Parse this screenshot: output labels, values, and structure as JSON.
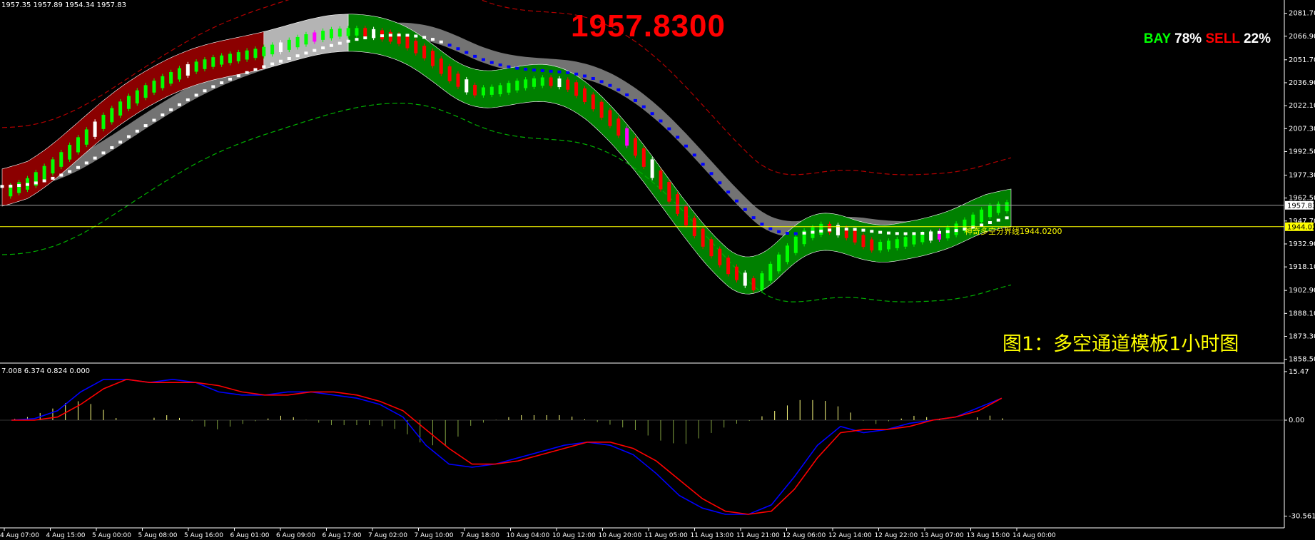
{
  "header": {
    "ohlc_text": "1957.35 1957.89 1954.34 1957.83",
    "big_price": "1957.8300",
    "signal": {
      "buy_label": "BAY",
      "buy_pct": "78%",
      "sell_label": "SELL",
      "sell_pct": "22%"
    },
    "caption": "图1：多空通道模板1小时图",
    "line_label": "神奇多空分界线1944.0200"
  },
  "macd_panel": {
    "info_text": "7.008 6.374 0.824 0.000"
  },
  "colors": {
    "up_candle": "#00ff00",
    "down_candle": "#ff0000",
    "white_candle": "#ffffff",
    "magenta_candle": "#ff00ff",
    "bull_channel": "#008000",
    "bear_channel": "#8b0000",
    "neutral_channel": "#b4b4b4",
    "gray_band": "#808080",
    "signal_dots_blue": "#0000ff",
    "signal_dots_white": "#ffffff",
    "macd_main": "#0000ff",
    "macd_signal": "#ff0000",
    "macd_hist": "#ffff80",
    "horizontal_line": "#ffff00"
  },
  "chart_data": {
    "type": "line",
    "y_ticks": [
      "2081.70",
      "2066.90",
      "2051.70",
      "2036.90",
      "2022.10",
      "2007.30",
      "1992.50",
      "1977.30",
      "1962.50",
      "1947.70",
      "1932.90",
      "1918.10",
      "1902.90",
      "1888.10",
      "1873.30",
      "1858.50"
    ],
    "ylim": [
      1856.5,
      2087.5
    ],
    "current_price_tag": "1957.83",
    "current_price": 1957.83,
    "level_line_tag": "1944.02",
    "level_line": 1944.02,
    "x_ticks": [
      "4 Aug 07:00",
      "4 Aug 15:00",
      "5 Aug 00:00",
      "5 Aug 08:00",
      "5 Aug 16:00",
      "6 Aug 01:00",
      "6 Aug 09:00",
      "6 Aug 17:00",
      "7 Aug 02:00",
      "7 Aug 10:00",
      "7 Aug 18:00",
      "10 Aug 04:00",
      "10 Aug 12:00",
      "10 Aug 20:00",
      "11 Aug 05:00",
      "11 Aug 13:00",
      "11 Aug 21:00",
      "12 Aug 06:00",
      "12 Aug 14:00",
      "12 Aug 22:00",
      "13 Aug 07:00",
      "13 Aug 15:00",
      "14 Aug 00:00"
    ],
    "price_series": [
      1966,
      1972,
      1983,
      1996,
      2010,
      2022,
      2032,
      2040,
      2047,
      2051,
      2054,
      2057,
      2061,
      2066,
      2069,
      2070,
      2068,
      2064,
      2055,
      2041,
      2031,
      2032,
      2036,
      2038,
      2036,
      2025,
      2010,
      1992,
      1972,
      1950,
      1931,
      1915,
      1905,
      1922,
      1938,
      1944,
      1939,
      1931,
      1933,
      1937,
      1939,
      1946,
      1955,
      1958
    ],
    "macd_ylim": [
      -32.5,
      17.5
    ],
    "macd_ticks": [
      "15.47",
      "0.00",
      "-30.561"
    ],
    "macd_main": [
      0,
      0.5,
      3,
      9,
      13,
      13,
      12,
      13,
      12,
      9,
      8,
      8,
      9,
      9,
      8,
      7,
      5,
      1,
      -8,
      -14,
      -15,
      -14,
      -12,
      -10,
      -8,
      -7,
      -8,
      -11,
      -17,
      -24,
      -28,
      -30,
      -30,
      -27,
      -18,
      -8,
      -2,
      -4,
      -3,
      -1,
      0,
      1,
      4,
      7
    ],
    "macd_signal": [
      0,
      0,
      1,
      5,
      10,
      13,
      12,
      12,
      12,
      11,
      9,
      8,
      8,
      9,
      9,
      8,
      6,
      3,
      -3,
      -9,
      -14,
      -14,
      -13,
      -11,
      -9,
      -7,
      -7,
      -9,
      -13,
      -19,
      -25,
      -29,
      -30,
      -29,
      -22,
      -12,
      -4,
      -3,
      -3,
      -2,
      0,
      1,
      3,
      7
    ],
    "macd_hist": [
      0,
      0.5,
      2,
      4,
      3,
      0,
      0,
      1,
      0,
      -2,
      -1,
      0,
      1,
      0,
      -1,
      -1,
      -1,
      -2,
      -5,
      -5,
      -1,
      0,
      1,
      1,
      1,
      0,
      -1,
      -2,
      -4,
      -5,
      -3,
      -1,
      0,
      2,
      4,
      4,
      2,
      -1,
      0,
      1,
      0,
      0,
      1,
      0
    ]
  }
}
